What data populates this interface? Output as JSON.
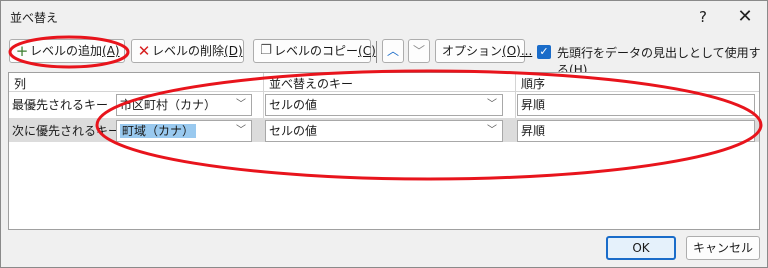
{
  "window": {
    "title": "並べ替え",
    "help_glyph": "?",
    "close_glyph": "✕"
  },
  "toolbar": {
    "add_label": "レベルの追加",
    "add_key": "(A)",
    "delete_label": "レベルの削除",
    "delete_key": "(D)",
    "copy_label": "レベルのコピー",
    "copy_key": "(C)",
    "options_label": "オプション",
    "options_key": "(O)...",
    "header_checkbox_label": "先頭行をデータの見出しとして使用する",
    "header_checkbox_key": "(H)",
    "header_checkbox_checked": true
  },
  "grid": {
    "columns": [
      "列",
      "並べ替えのキー",
      "順序"
    ],
    "rows": [
      {
        "label": "最優先されるキー",
        "column": "市区町村（カナ）",
        "sort_on": "セルの値",
        "order": "昇順",
        "selected": false
      },
      {
        "label": "次に優先されるキー",
        "column": "町域（カナ）",
        "sort_on": "セルの値",
        "order": "昇順",
        "selected": true
      }
    ]
  },
  "footer": {
    "ok_label": "OK",
    "cancel_label": "キャンセル"
  },
  "annotation_color": "#e8141c"
}
